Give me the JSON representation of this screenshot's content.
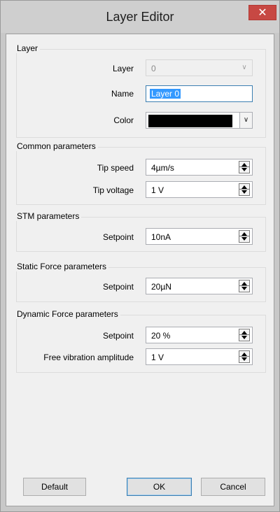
{
  "window": {
    "title": "Layer Editor",
    "close_glyph": "✕"
  },
  "groups": {
    "layer": {
      "title": "Layer",
      "layer_label": "Layer",
      "layer_value": "0",
      "name_label": "Name",
      "name_value": "Layer 0",
      "color_label": "Color",
      "color_value": "#000000"
    },
    "common": {
      "title": "Common parameters",
      "tip_speed_label": "Tip speed",
      "tip_speed_value": "4µm/s",
      "tip_voltage_label": "Tip voltage",
      "tip_voltage_value": "1 V"
    },
    "stm": {
      "title": "STM parameters",
      "setpoint_label": "Setpoint",
      "setpoint_value": "10nA"
    },
    "static_force": {
      "title": "Static Force parameters",
      "setpoint_label": "Setpoint",
      "setpoint_value": "20µN"
    },
    "dynamic_force": {
      "title": "Dynamic Force parameters",
      "setpoint_label": "Setpoint",
      "setpoint_value": "20 %",
      "amplitude_label": "Free vibration amplitude",
      "amplitude_value": "1 V"
    }
  },
  "buttons": {
    "default": "Default",
    "ok": "OK",
    "cancel": "Cancel"
  },
  "icons": {
    "close": "close-icon",
    "dropdown": "chevron-down-icon",
    "spinner": "spinner-icon"
  }
}
